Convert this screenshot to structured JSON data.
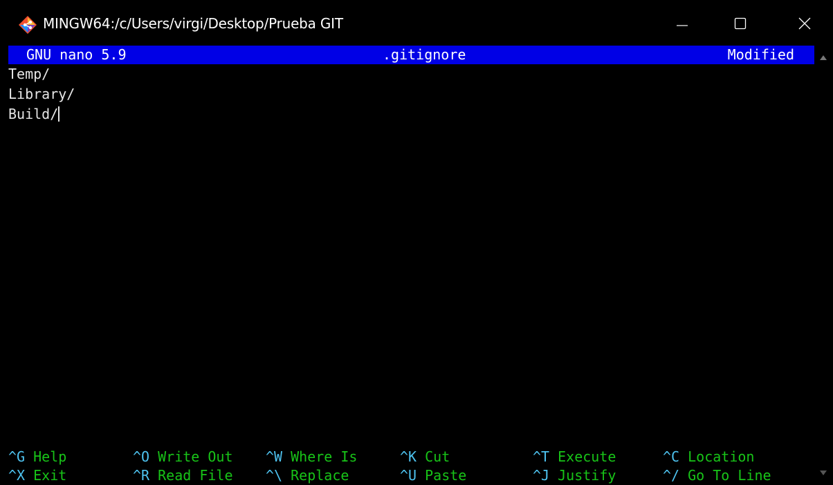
{
  "window": {
    "title": "MINGW64:/c/Users/virgi/Desktop/Prueba GIT",
    "icon": "git-bash-icon",
    "controls": [
      "minimize-icon",
      "maximize-icon",
      "close-icon"
    ]
  },
  "nano": {
    "version_label": "GNU nano 5.9",
    "filename": ".gitignore",
    "state": "Modified"
  },
  "editor": {
    "lines": [
      "Temp/",
      "Library/",
      "Build/"
    ]
  },
  "shortcuts": [
    {
      "key": "^G",
      "label": "Help"
    },
    {
      "key": "^O",
      "label": "Write Out"
    },
    {
      "key": "^W",
      "label": "Where Is"
    },
    {
      "key": "^K",
      "label": "Cut"
    },
    {
      "key": "^T",
      "label": "Execute"
    },
    {
      "key": "^C",
      "label": "Location"
    },
    {
      "key": "^X",
      "label": "Exit"
    },
    {
      "key": "^R",
      "label": "Read File"
    },
    {
      "key": "^\\",
      "label": "Replace"
    },
    {
      "key": "^U",
      "label": "Paste"
    },
    {
      "key": "^J",
      "label": "Justify"
    },
    {
      "key": "^/",
      "label": "Go To Line"
    }
  ],
  "colors": {
    "statusbar_bg": "#0000e6",
    "key": "#4ec3f0",
    "label": "#18c418",
    "text": "#e6e6e6"
  }
}
